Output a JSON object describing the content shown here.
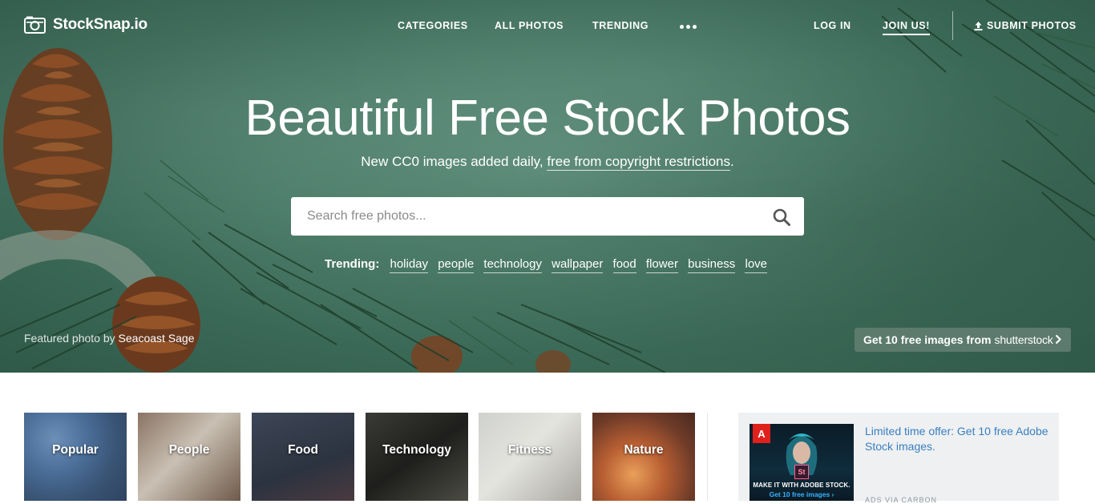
{
  "brand": {
    "name": "StockSnap.io"
  },
  "nav": {
    "categories": "CATEGORIES",
    "all_photos": "ALL PHOTOS",
    "trending": "TRENDING",
    "log_in": "LOG IN",
    "join": "JOIN US!",
    "submit": "SUBMIT PHOTOS"
  },
  "hero": {
    "headline": "Beautiful Free Stock Photos",
    "sub_prefix": "New CC0 images added daily, ",
    "sub_link": "free from copyright restrictions",
    "sub_suffix": ".",
    "search_placeholder": "Search free photos...",
    "trending_label": "Trending:",
    "trending_tags": [
      "holiday",
      "people",
      "technology",
      "wallpaper",
      "food",
      "flower",
      "business",
      "love"
    ],
    "featured_prefix": "Featured photo by ",
    "featured_author": "Seacoast Sage",
    "promo_prefix": "Get 10 free images from",
    "promo_brand": "shutterstock"
  },
  "categories": [
    "Popular",
    "People",
    "Food",
    "Technology",
    "Fitness",
    "Nature"
  ],
  "ad": {
    "logo": "A",
    "badge": "St",
    "caption_1": "MAKE IT WITH ADOBE STOCK.",
    "caption_2": "Get 10 free images ›",
    "text": "Limited time offer: Get 10 free Adobe Stock images.",
    "via": "ADS VIA CARBON"
  },
  "colors": {
    "hero_green": "#4c7d6a",
    "ad_link": "#3a7fc0",
    "ad_background": "#eef0f2"
  }
}
